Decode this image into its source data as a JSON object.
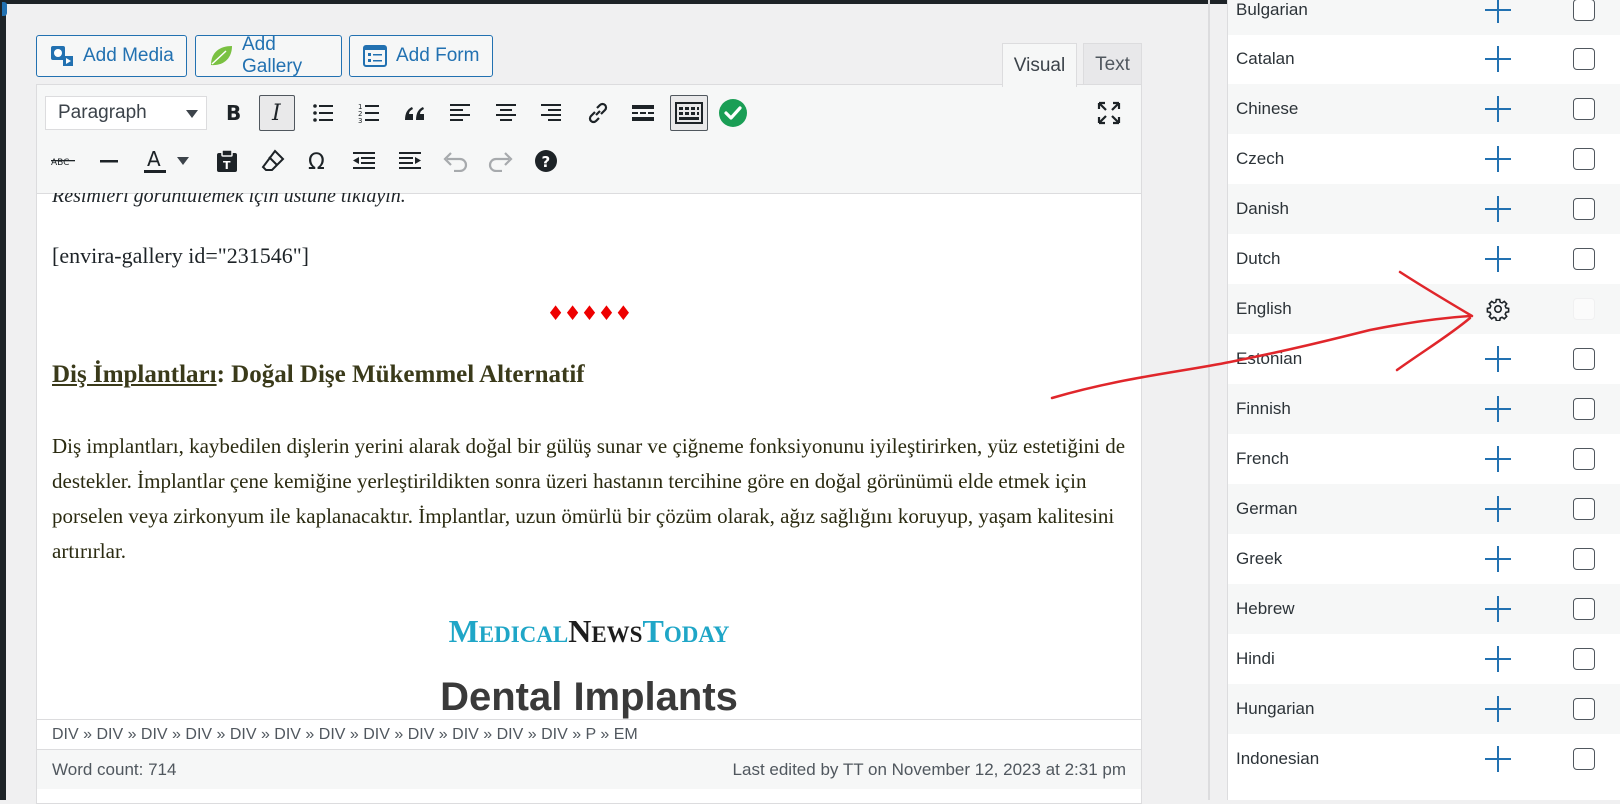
{
  "media_buttons": {
    "add_media": "Add Media",
    "add_gallery": "Add Gallery",
    "add_form": "Add Form"
  },
  "editor_tabs": {
    "visual": "Visual",
    "text": "Text"
  },
  "toolbar": {
    "format_select": "Paragraph",
    "row1": [
      "bold-icon",
      "italic-icon",
      "bullet-list-icon",
      "numbered-list-icon",
      "blockquote-icon",
      "align-left-icon",
      "align-center-icon",
      "align-right-icon",
      "link-icon",
      "read-more-icon",
      "toolbar-toggle-icon",
      "checkmark-icon",
      "fullscreen-icon"
    ],
    "row2": [
      "strikethrough-icon",
      "horizontal-line-icon",
      "text-color-icon",
      "paste-text-icon",
      "clear-formatting-icon",
      "special-character-icon",
      "outdent-icon",
      "indent-icon",
      "undo-icon",
      "redo-icon",
      "help-icon"
    ],
    "accent_color": "#2271b1",
    "check_color": "#1a9e55"
  },
  "content": {
    "intro_italic": "Resimleri görüntülemek için üstüne tıklayın.",
    "shortcode": "[envira-gallery id=\"231546\"]",
    "diamonds": "♦♦♦♦♦",
    "heading_link": "Diş İmplantları",
    "heading_rest": ": Doğal Dişe Mükemmel Alternatif",
    "paragraph": "Diş implantları, kaybedilen dişlerin yerini alarak doğal bir gülüş sunar ve çiğneme fonksiyonunu iyileştirirken, yüz estetiğini de destekler. İmplantlar çene kemiğine yerleştirildikten sonra üzeri hastanın tercihine göre en doğal görünümü elde etmek için porselen veya zirkonyum ile kaplanacaktır. İmplantlar, uzun ömürlü bir çözüm olarak, ağız sağlığını koruyup, yaşam kalitesini artırırlar.",
    "logo_medical": "MedicalNews",
    "logo_m": "M",
    "logo_edical": "EDICAL",
    "logo_n": "N",
    "logo_ews": "EWS",
    "logo_t": "T",
    "logo_oday": "ODAY",
    "image_title": "Dental Implants"
  },
  "path_bar": "DIV » DIV » DIV » DIV » DIV » DIV » DIV » DIV » DIV » DIV » DIV » DIV » P » EM",
  "status_bar": {
    "word_count": "Word count: 714",
    "last_edited": "Last edited by TT on November 12, 2023 at 2:31 pm"
  },
  "languages": [
    {
      "name": "Bulgarian",
      "action": "add"
    },
    {
      "name": "Catalan",
      "action": "add"
    },
    {
      "name": "Chinese",
      "action": "add"
    },
    {
      "name": "Czech",
      "action": "add"
    },
    {
      "name": "Danish",
      "action": "add"
    },
    {
      "name": "Dutch",
      "action": "add"
    },
    {
      "name": "English",
      "action": "settings"
    },
    {
      "name": "Estonian",
      "action": "add"
    },
    {
      "name": "Finnish",
      "action": "add"
    },
    {
      "name": "French",
      "action": "add"
    },
    {
      "name": "German",
      "action": "add"
    },
    {
      "name": "Greek",
      "action": "add"
    },
    {
      "name": "Hebrew",
      "action": "add"
    },
    {
      "name": "Hindi",
      "action": "add"
    },
    {
      "name": "Hungarian",
      "action": "add"
    },
    {
      "name": "Indonesian",
      "action": "add"
    }
  ],
  "annotation_color": "#e0262b"
}
